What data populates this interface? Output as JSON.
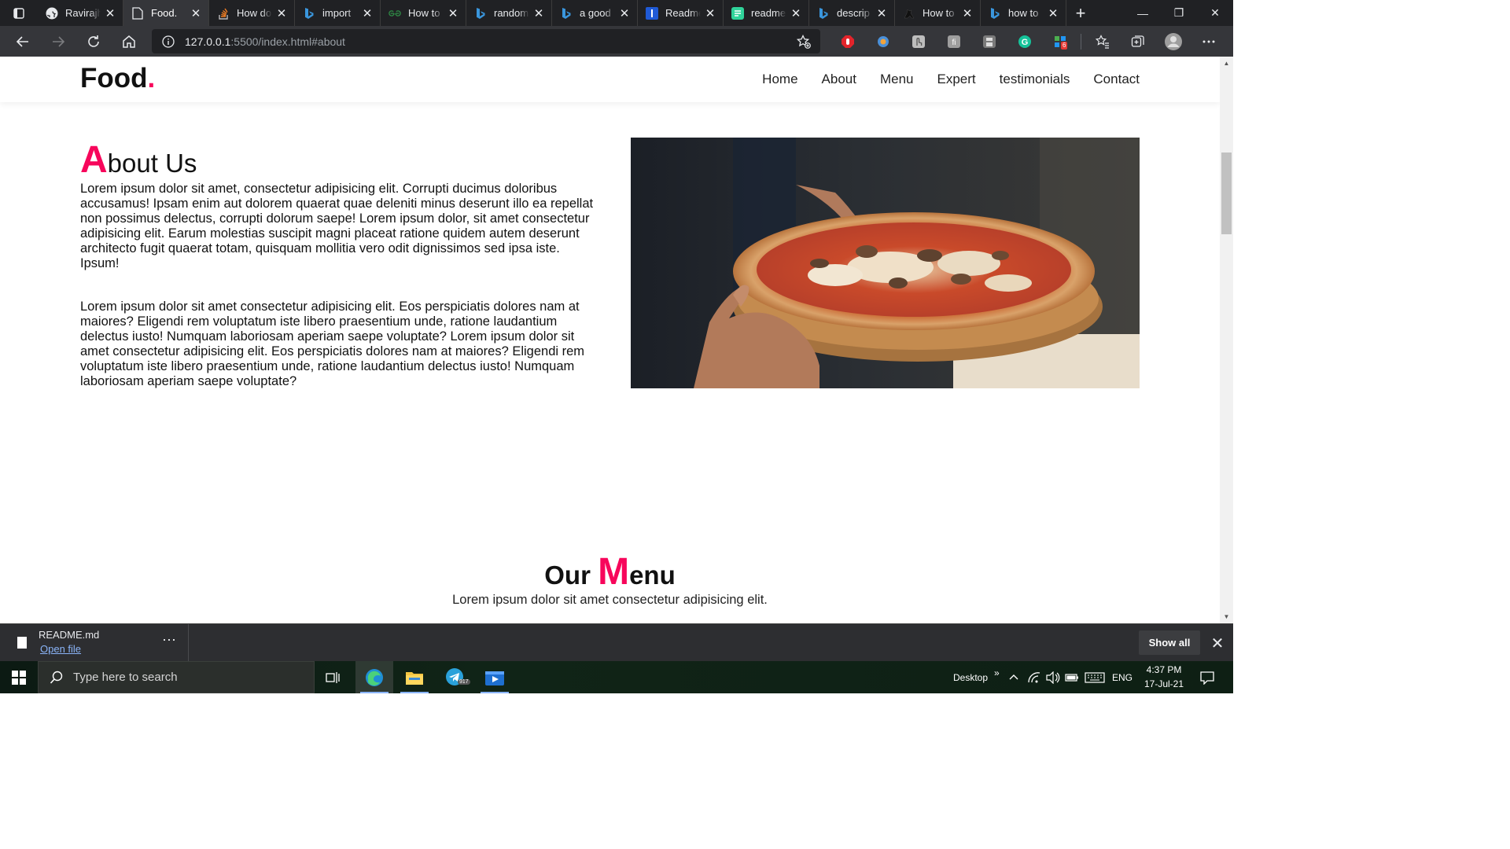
{
  "browser": {
    "tabs": [
      {
        "label": "Ravirajh",
        "icon": "github-icon",
        "active": false
      },
      {
        "label": "Food.",
        "icon": "page-icon",
        "active": true
      },
      {
        "label": "How do",
        "icon": "stackoverflow-icon",
        "active": false
      },
      {
        "label": "import",
        "icon": "bing-icon",
        "active": false
      },
      {
        "label": "How to",
        "icon": "geeksforgeeks-icon",
        "active": false
      },
      {
        "label": "random",
        "icon": "bing-icon",
        "active": false
      },
      {
        "label": "a good",
        "icon": "bing-icon",
        "active": false
      },
      {
        "label": "Readme",
        "icon": "readme-icon",
        "active": false
      },
      {
        "label": "readme",
        "icon": "readme-so-icon",
        "active": false
      },
      {
        "label": "descrip",
        "icon": "bing-icon",
        "active": false
      },
      {
        "label": "How to",
        "icon": "dog-icon",
        "active": false
      },
      {
        "label": "how to",
        "icon": "bing-icon",
        "active": false
      }
    ],
    "url_main": "127.0.0.1",
    "url_rest": ":5500/index.html#about",
    "extension_badge": "6"
  },
  "site": {
    "logo": "Food",
    "logo_dot": ".",
    "nav": [
      "Home",
      "About",
      "Menu",
      "Expert",
      "testimonials",
      "Contact"
    ],
    "about": {
      "title_first": "A",
      "title_rest": "bout Us",
      "p1": "Lorem ipsum dolor sit amet, consectetur adipisicing elit. Corrupti ducimus doloribus accusamus! Ipsam enim aut dolorem quaerat quae deleniti minus deserunt illo ea repellat non possimus delectus, corrupti dolorum saepe! Lorem ipsum dolor, sit amet consectetur adipisicing elit. Earum molestias suscipit magni placeat ratione quidem autem deserunt architecto fugit quaerat totam, quisquam mollitia vero odit dignissimos sed ipsa iste. Ipsum!",
      "p2": "Lorem ipsum dolor sit amet consectetur adipisicing elit. Eos perspiciatis dolores nam at maiores? Eligendi rem voluptatum iste libero praesentium unde, ratione laudantium delectus iusto! Numquam laboriosam aperiam saepe voluptate? Lorem ipsum dolor sit amet consectetur adipisicing elit. Eos perspiciatis dolores nam at maiores? Eligendi rem voluptatum iste libero praesentium unde, ratione laudantium delectus iusto! Numquam laboriosam aperiam saepe voluptate?",
      "image": "pizza-photo"
    },
    "menu": {
      "title_pre": "Our ",
      "title_first": "M",
      "title_rest": "enu",
      "subtitle": "Lorem ipsum dolor sit amet consectetur adipisicing elit."
    },
    "accent_color": "#f7065b"
  },
  "downloads": {
    "file_name": "README.md",
    "open_label": "Open file",
    "show_all": "Show all"
  },
  "taskbar": {
    "search_placeholder": "Type here to search",
    "telegram_badge": "917",
    "desktop_label": "Desktop",
    "language": "ENG",
    "time": "4:37 PM",
    "date": "17-Jul-21"
  }
}
